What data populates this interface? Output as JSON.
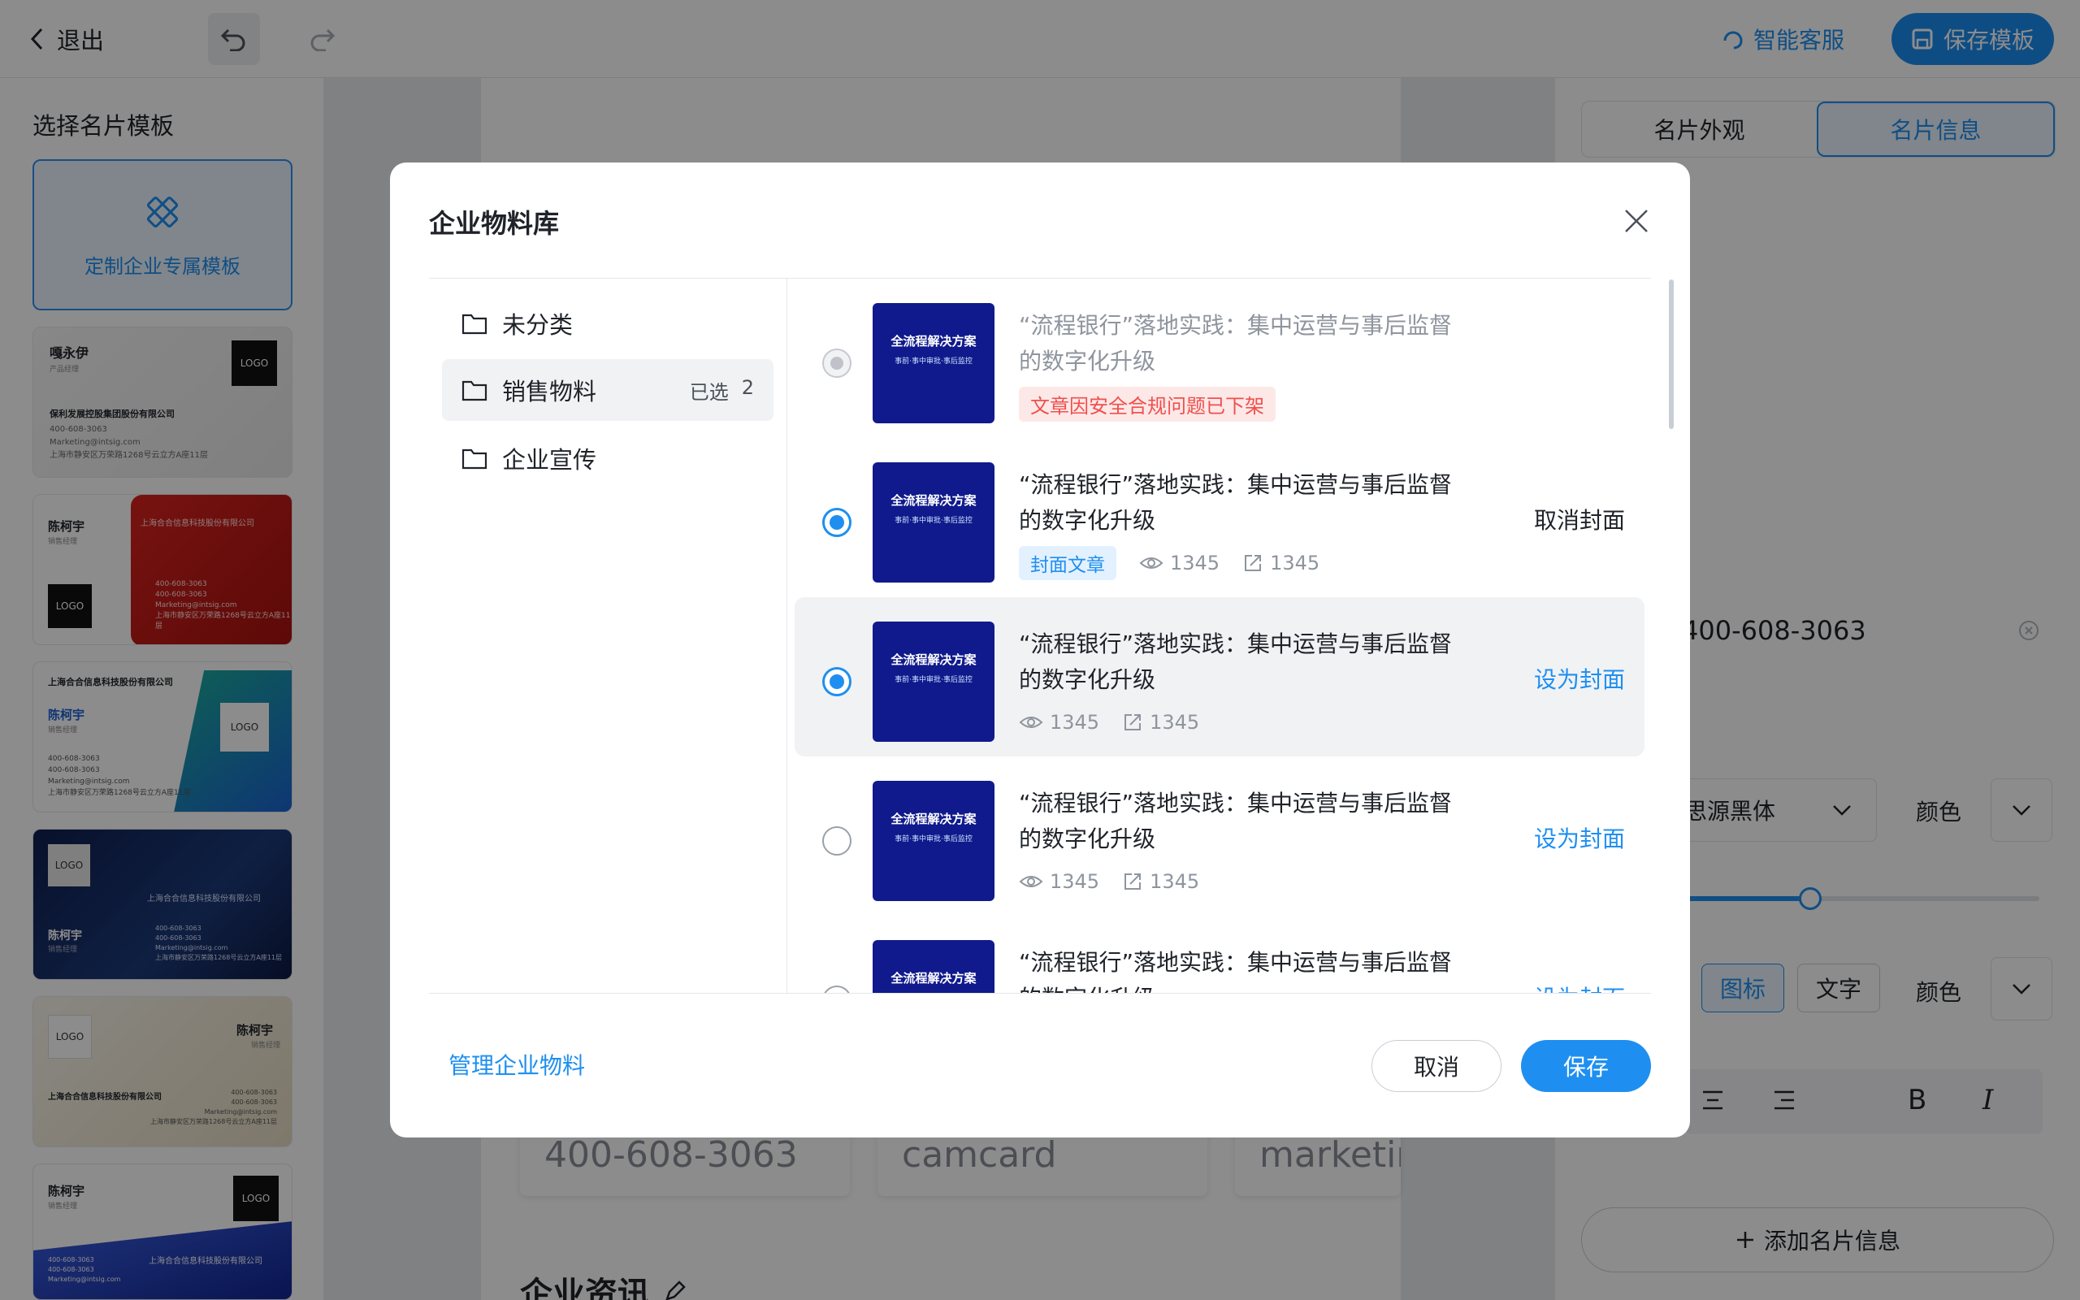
{
  "topbar": {
    "back_label": "退出",
    "service_label": "智能客服",
    "save_template_label": "保存模板"
  },
  "left_panel": {
    "title": "选择名片模板",
    "custom_label": "定制企业专属模板",
    "cards": [
      {
        "name": "嘎永伊",
        "role": "产品经理",
        "company": "保利发展控股集团股份有限公司",
        "phone": "400-608-3063",
        "email": "Marketing@intsig.com",
        "address": "上海市静安区万荣路1268号云立方A座11层",
        "logo": "LOGO"
      },
      {
        "name": "陈柯宇",
        "role": "销售经理",
        "company": "上海合合信息科技股份有限公司",
        "phone1": "400-608-3063",
        "phone2": "400-608-3063",
        "email": "Marketing@intsig.com",
        "address": "上海市静安区万荣路1268号云立方A座11层",
        "logo": "LOGO"
      },
      {
        "name": "陈柯宇",
        "role": "销售经理",
        "company": "上海合合信息科技股份有限公司",
        "phone1": "400-608-3063",
        "phone2": "400-608-3063",
        "email": "Marketing@intsig.com",
        "address": "上海市静安区万荣路1268号云立方A座11层",
        "logo": "LOGO"
      },
      {
        "name": "陈柯宇",
        "role": "销售经理",
        "company": "上海合合信息科技股份有限公司",
        "phone1": "400-608-3063",
        "phone2": "400-608-3063",
        "email": "Marketing@intsig.com",
        "address": "上海市静安区万荣路1268号云立方A座11层",
        "logo": "LOGO"
      },
      {
        "name": "陈柯宇",
        "role": "销售经理",
        "company": "上海合合信息科技股份有限公司",
        "phone1": "400-608-3063",
        "phone2": "400-608-3063",
        "email": "Marketing@intsig.com",
        "address": "上海市静安区万荣路1268号云立方A座11层",
        "logo": "LOGO"
      },
      {
        "name": "陈柯宇",
        "role": "销售经理",
        "company": "上海合合信息科技股份有限公司",
        "phone1": "400-608-3063",
        "phone2": "400-608-3063",
        "email": "Marketing@intsig.com",
        "logo": "LOGO"
      }
    ]
  },
  "canvas": {
    "fields": [
      "400-608-3063",
      "camcard",
      "marketing"
    ],
    "section_title": "企业资讯"
  },
  "right_panel": {
    "tabs": [
      "名片外观",
      "名片信息"
    ],
    "phone_value": "400-608-3063",
    "font_value": "思源黑体",
    "color_label": "颜色",
    "type_options": [
      "图标",
      "文字"
    ],
    "color_label2": "颜色",
    "add_info_label": "添加名片信息"
  },
  "dialog": {
    "title": "企业物料库",
    "folders": [
      {
        "label": "未分类"
      },
      {
        "label": "销售物料",
        "selected_label": "已选",
        "selected_count": "2"
      },
      {
        "label": "企业宣传"
      }
    ],
    "thumb_title": "全流程解决方案",
    "thumb_sub": "事前·事中审批·事后监控",
    "items": [
      {
        "title": "“流程银行”落地实践：集中运营与事后监督的数字化升级",
        "state": "disabled",
        "tag": "文章因安全合规问题已下架"
      },
      {
        "title": "“流程银行”落地实践：集中运营与事后监督的数字化升级",
        "state": "checked",
        "tag": "封面文章",
        "views": "1345",
        "shares": "1345",
        "action": "取消封面"
      },
      {
        "title": "“流程银行”落地实践：集中运营与事后监督的数字化升级",
        "state": "checked",
        "views": "1345",
        "shares": "1345",
        "action": "设为封面"
      },
      {
        "title": "“流程银行”落地实践：集中运营与事后监督的数字化升级",
        "state": "unchecked",
        "views": "1345",
        "shares": "1345",
        "action": "设为封面"
      },
      {
        "title": "“流程银行”落地实践：集中运营与事后监督的数字化升级",
        "state": "unchecked",
        "action": "设为封面"
      }
    ],
    "manage_label": "管理企业物料",
    "cancel_label": "取消",
    "save_label": "保存"
  },
  "colors": {
    "accent": "#1e8ff0",
    "danger": "#f0504c"
  }
}
